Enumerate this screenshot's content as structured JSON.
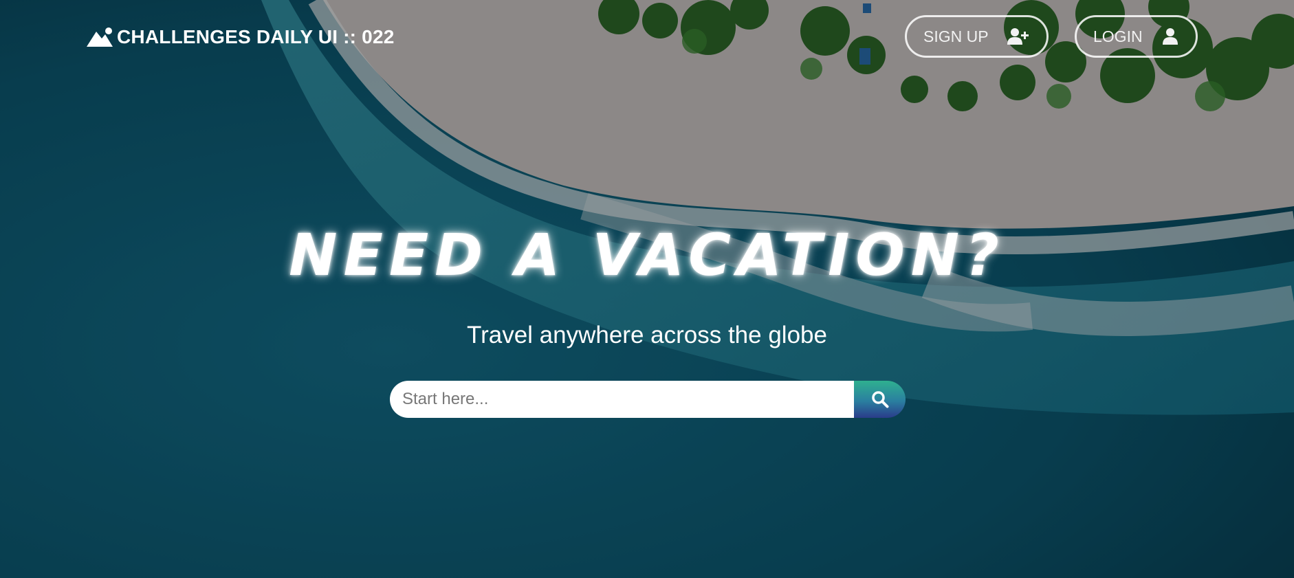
{
  "brand": {
    "name": "CHALLENGES DAILY UI :: 022",
    "icon": "mountain-icon"
  },
  "nav": {
    "signup": {
      "label": "SIGN UP",
      "icon": "user-plus-icon"
    },
    "login": {
      "label": "LOGIN",
      "icon": "user-icon"
    }
  },
  "hero": {
    "headline": "NEED A VACATION?",
    "subtitle": "Travel anywhere across the globe"
  },
  "search": {
    "placeholder": "Start here...",
    "value": "",
    "button_icon": "search-icon"
  },
  "colors": {
    "ocean": "#0d4f66",
    "sand": "#c9c4c3",
    "foliage": "#2f6b2a",
    "search_button_top": "#2fb08f",
    "search_button_bottom": "#2a3c8a"
  }
}
